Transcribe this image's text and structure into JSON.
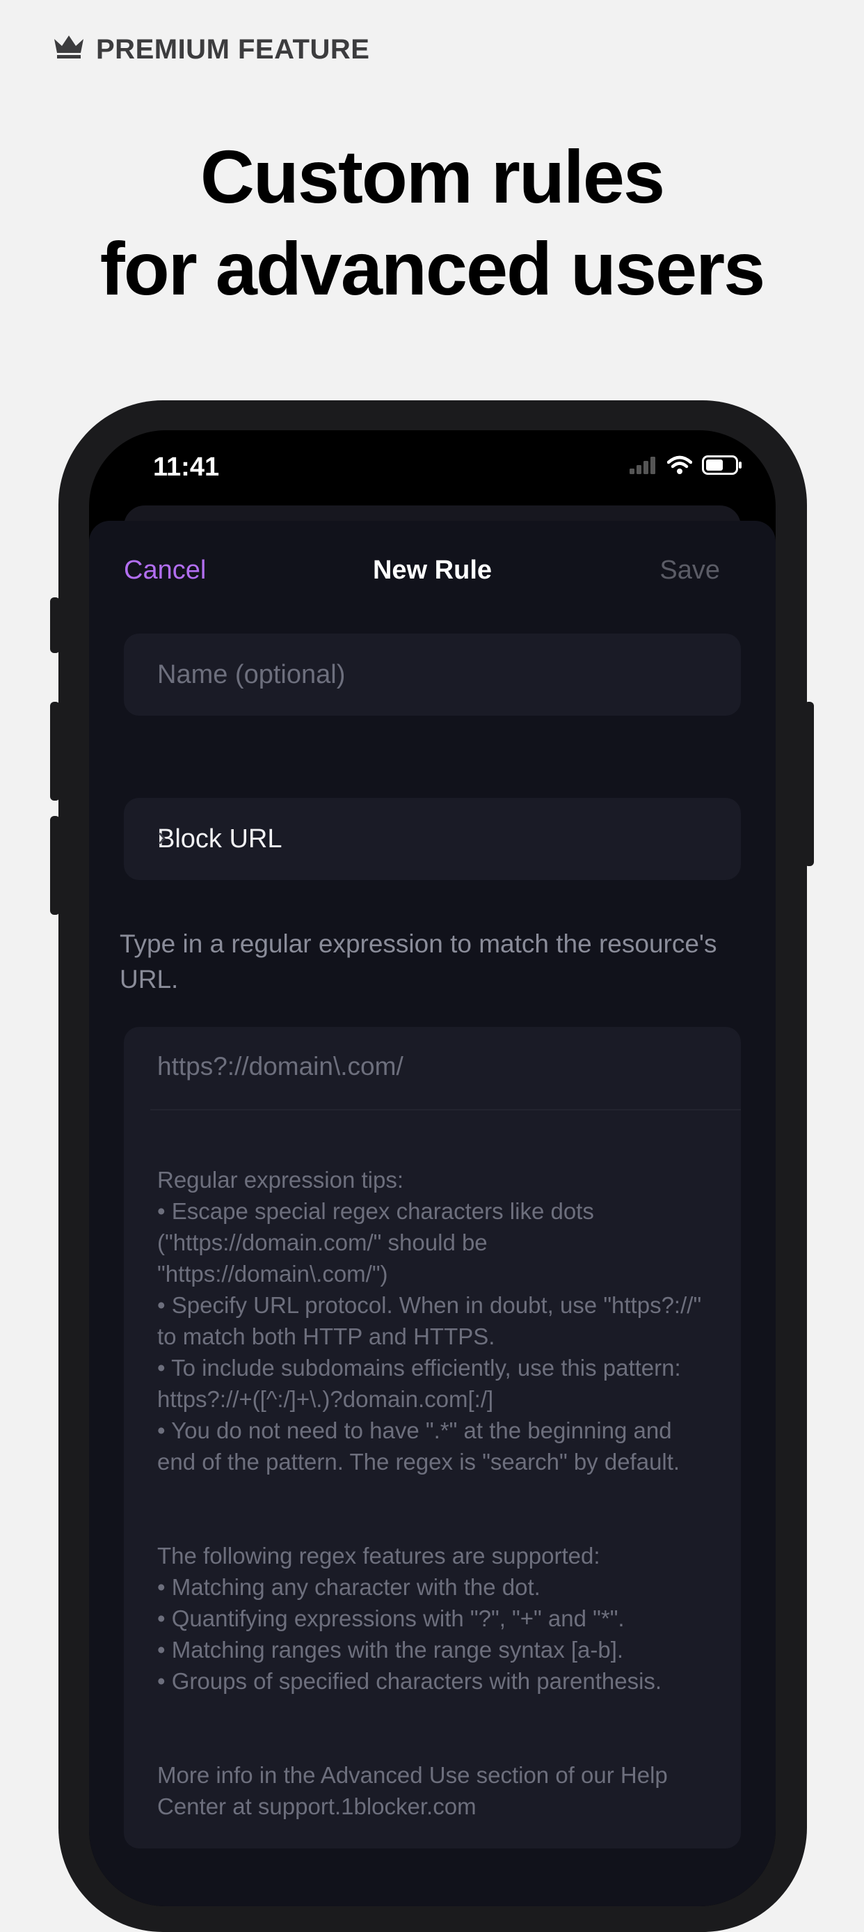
{
  "badge": {
    "icon": "crown-icon",
    "label": "PREMIUM FEATURE"
  },
  "headline": {
    "line1": "Custom rules",
    "line2": "for advanced users"
  },
  "status_bar": {
    "time": "11:41"
  },
  "nav": {
    "cancel": "Cancel",
    "title": "New Rule",
    "save": "Save"
  },
  "form": {
    "name_placeholder": "Name (optional)",
    "rule_type": "Block URL",
    "description": "Type in a regular expression to match the resource's URL.",
    "regex_placeholder": "https?://domain\\.com/",
    "tips_1": "Regular expression tips:\n• Escape special regex characters like dots (\"https://domain.com/\" should be \"https://domain\\.com/\")\n• Specify URL protocol. When in doubt, use \"https?://\" to match both HTTP and HTTPS.\n• To include subdomains efficiently, use this pattern:\nhttps?://+([^:/]+\\.)?domain.com[:/]\n• You do not need to have \".*\" at the beginning and end of the pattern. The regex is \"search\" by default.",
    "tips_2": "The following regex features are supported:\n• Matching any character with the dot.\n• Quantifying expressions with \"?\", \"+\" and \"*\".\n• Matching ranges with the range syntax [a-b].\n• Groups of specified characters with parenthesis.",
    "tips_3": "More info in the Advanced Use section of our Help Center at support.1blocker.com"
  },
  "colors": {
    "accent": "#b26ef0",
    "sheet_bg": "#11121b",
    "field_bg": "#1a1b26",
    "page_bg": "#f2f2f2"
  }
}
